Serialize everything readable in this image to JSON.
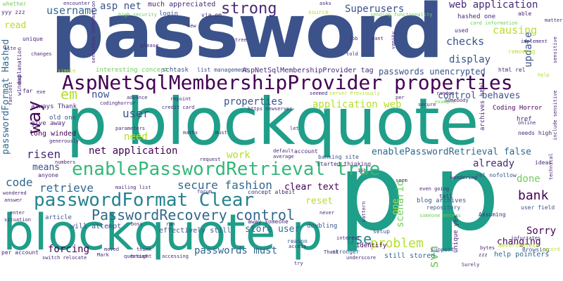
{
  "palette": {
    "dark_purple": "#440154",
    "indigo": "#482878",
    "blue": "#3b528b",
    "steel_blue": "#31688e",
    "teal_blue": "#26828e",
    "teal": "#1f9e89",
    "green": "#35b779",
    "light_green": "#6ece58",
    "lime": "#b5de2b",
    "yellow": "#fde725"
  },
  "words": {
    "password": "password",
    "p_blockquote": "p blockquote",
    "p_p": "p p",
    "blockquote_p": "blockquote p",
    "aspnet_props": "AspNetSqlMembershipProvider properties",
    "enable_pwd_true": "enablePasswordRetrieval true",
    "pwd_format_clear": "passwordFormat Clear",
    "pwd_recovery": "PasswordRecovery control",
    "strong": "strong",
    "web_application": "web application",
    "superusers": "Superusers",
    "username": "username",
    "asp_net": "asp net",
    "em": "em",
    "way": "way",
    "user": "user",
    "now": "now",
    "net_application": "net application",
    "need": "need",
    "risen": "risen",
    "means": "means",
    "code": "code",
    "retrieve": "retrieve",
    "secure_fashion": "secure fashion",
    "work": "work",
    "application_web": "application web",
    "properties": "properties",
    "checks": "checks",
    "causing": "causing",
    "display": "display",
    "update": "update",
    "control_behaves": "control behaves",
    "enable_pwd_false": "enablePasswordRetrieval false",
    "already": "already",
    "done": "done",
    "bank": "bank",
    "scenario": "scenario",
    "reset": "reset",
    "clear_text": "clear text",
    "store_user": "store user",
    "use": "use",
    "problem": "problem",
    "one": "one",
    "sorry": "Sorry",
    "changing": "changing",
    "svn": "svn",
    "forcing": "forcing",
    "passwords_must": "passwords must",
    "pwd_format_hashed": "passwordFormat Hashed",
    "read": "read",
    "pwds_unencrypted": "passwords unencrypted",
    "aspnet_tag": "AspNetSqlMembershipProvider tag",
    "much_appreciated": "much appreciated",
    "login": "login",
    "schtask": "schtask",
    "interesting_concept": "interesting concept",
    "list_management": "list management",
    "long_winded": "long winded",
    "always_thank": "always Thank",
    "old_one": "old one",
    "give_away": "give away",
    "coding_horror": "Coding Horror",
    "help_pointers": "help pointers",
    "still_stored": "still stored",
    "effectively_still": "effectively still",
    "will_attempt": "will attempt",
    "identify": "identify",
    "hashed_one": "hashed one",
    "needs_high": "needs high",
    "banking_site": "banking site",
    "started_thinking": "started thinking",
    "blog_archives": "blog archives",
    "rel_nofollow": "rel nofollow",
    "user_field": "user field",
    "browsing": "Browsing",
    "nevertheless": "Nevertheless",
    "infuriates": "infuriates",
    "repository": "repository",
    "article": "article",
    "doubling": "doubling",
    "setup": "setup",
    "reason": "reason",
    "stronger": "stronger",
    "support": "support",
    "yyy_zzz": "yyy zzz",
    "whether": "whether",
    "encounter": "encounter",
    "via_em": "via em",
    "source": "source",
    "sending_functionality": "sending functionality",
    "able": "able",
    "matter": "matter",
    "high_security": "high security",
    "login_dialog": "login dialog",
    "card_information": "card information",
    "used": "used",
    "implement": "implement",
    "removing": "removing",
    "unique": "unique",
    "asks": "asks",
    "told": "told",
    "want": "want",
    "tree": "tree",
    "please": "please",
    "new": "new",
    "html_rel": "html rel",
    "help": "help",
    "simple": "simple",
    "instead": "instead",
    "changes": "changes",
    "credit_card": "credit card",
    "repoint": "repoint",
    "codinghorror": "codinghorror",
    "advance": "advance",
    "https_newserver": "https newserver",
    "server_previously": "server Previously",
    "secure": "secure",
    "example": "example",
    "random": "random",
    "someboody": "SOmebody",
    "href": "href",
    "online": "online",
    "let": "let",
    "maths": "maths",
    "must": "must",
    "parameters": "parameters",
    "generously": "generously",
    "default": "default",
    "average": "average",
    "account": "account",
    "request": "request",
    "ideas": "ideas",
    "technical": "technical",
    "wondering": "wondering",
    "seem": "seem",
    "even_going": "even going",
    "tell": "tell",
    "assuming": "Assuming",
    "anyone": "anyone",
    "mailing_list": "mailing list",
    "forum": "forum",
    "concept_albeit": "concept albeit",
    "away_someone": "away someone",
    "wondered": "wondered",
    "answer": "answer",
    "enter": "enter",
    "situation": "situation",
    "boss": "boss",
    "run": "run",
    "never": "never",
    "pattern": "pattern",
    "someone_enters": "someone enters",
    "record": "record",
    "bytes": "bytes",
    "zzz": "zzz",
    "access": "access",
    "interest": "interest",
    "surely": "Surely",
    "per_account": "per account",
    "switch_relocate": "switch relocate",
    "moved": "moved",
    "question": "question",
    "brought": "brought",
    "think": "think",
    "try": "try",
    "underscore": "underscore",
    "thank": "Thank",
    "accessing": "accessing",
    "mark": "Mark",
    "seemed": "seemed",
    "num_t": "16b",
    "numbers": "numbers",
    "include_sensitive": "include sensitive",
    "sensitive_information": "sensitive information",
    "explanation": "explanation",
    "winded": "winded",
    "fanciest": "fanciest",
    "far": "far",
    "exe": "exe",
    "per": "per",
    "vanity": "vanity",
    "site": "site",
    "job": "job",
    "yes": "yes",
    "unique_yes": "unique yes",
    "archives_html": "archives html",
    "sensitive": "sensitive"
  }
}
